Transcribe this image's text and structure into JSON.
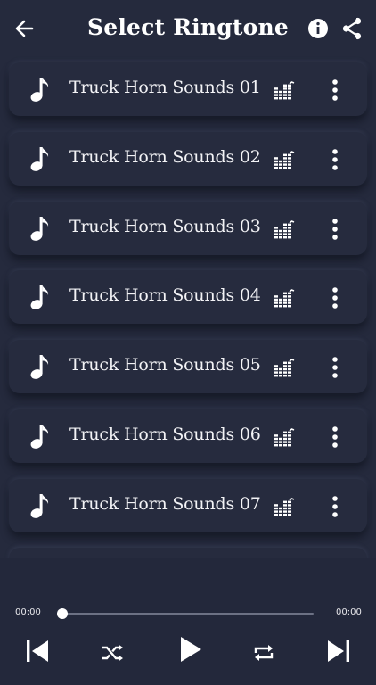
{
  "header": {
    "title": "Select Ringtone",
    "back_icon": "arrow-left-icon",
    "info_icon": "info-icon",
    "share_icon": "share-icon"
  },
  "ringtones": [
    {
      "label": "Truck Horn Sounds 01"
    },
    {
      "label": "Truck Horn Sounds 02"
    },
    {
      "label": "Truck Horn Sounds 03"
    },
    {
      "label": "Truck Horn Sounds 04"
    },
    {
      "label": "Truck Horn Sounds 05"
    },
    {
      "label": "Truck Horn Sounds 06"
    },
    {
      "label": "Truck Horn Sounds 07"
    }
  ],
  "player": {
    "current_time": "00:00",
    "total_time": "00:00",
    "progress": 0
  },
  "colors": {
    "background": "#252a3d",
    "card": "#262b3e",
    "text": "#ffffff"
  }
}
